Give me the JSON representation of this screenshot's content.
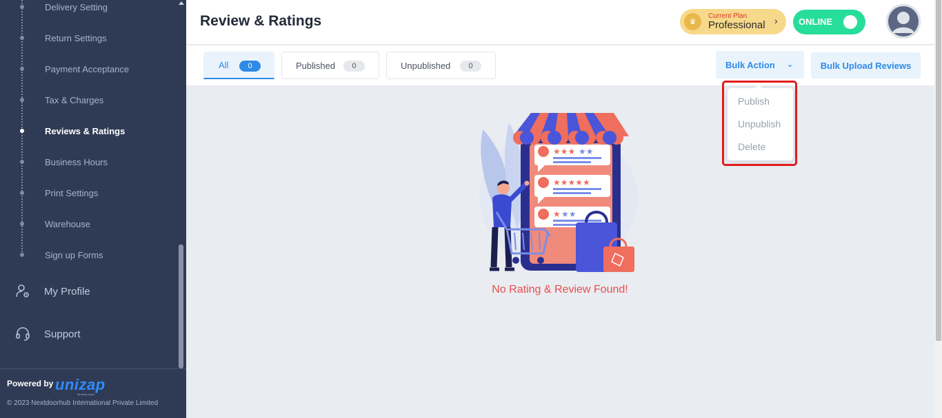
{
  "sidebar": {
    "sub_items": [
      {
        "label": "Delivery Setting"
      },
      {
        "label": "Return Settings"
      },
      {
        "label": "Payment Acceptance"
      },
      {
        "label": "Tax & Charges"
      },
      {
        "label": "Reviews & Ratings",
        "active": true
      },
      {
        "label": "Business Hours"
      },
      {
        "label": "Print Settings"
      },
      {
        "label": "Warehouse"
      },
      {
        "label": "Sign up Forms"
      }
    ],
    "main_items": [
      {
        "label": "My Profile",
        "icon": "user-gear-icon"
      },
      {
        "label": "Support",
        "icon": "headset-icon"
      }
    ],
    "powered_by": "Powered by",
    "brand": "unizap",
    "brand_tag": "formerly zoylo",
    "copyright": "© 2023 Nextdoorhub International Private Limited"
  },
  "header": {
    "title": "Review & Ratings",
    "plan_caption": "Current Plan",
    "plan_name": "Professional",
    "status": "ONLINE"
  },
  "tabs": [
    {
      "label": "All",
      "count": "0",
      "active": true
    },
    {
      "label": "Published",
      "count": "0"
    },
    {
      "label": "Unpublished",
      "count": "0"
    }
  ],
  "actions": {
    "bulk_action": "Bulk Action",
    "bulk_upload": "Bulk Upload Reviews"
  },
  "bulk_menu": [
    "Publish",
    "Unpublish",
    "Delete"
  ],
  "empty_state": {
    "message": "No Rating & Review Found!"
  },
  "colors": {
    "sidebar_bg": "#2f3b55",
    "accent": "#2e8ae6",
    "online": "#27dd9a",
    "plan": "#f6d98a",
    "empty_text": "#ea4d4d",
    "highlight": "#e21b1b"
  }
}
